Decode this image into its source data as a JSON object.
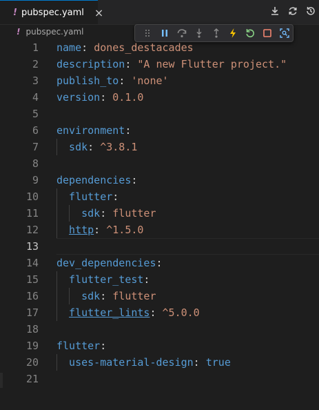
{
  "tab": {
    "filename": "pubspec.yaml",
    "close_label": "×",
    "marker": "!"
  },
  "breadcrumb": {
    "filename": "pubspec.yaml",
    "marker": "!"
  },
  "toolbar_icons": [
    "download-icon",
    "sync-icon",
    "history-icon"
  ],
  "debug_toolbar": [
    "drag-grip-icon",
    "pause-icon",
    "step-over-icon",
    "step-into-icon",
    "step-out-icon",
    "hot-reload-icon",
    "restart-icon",
    "stop-icon",
    "inspect-widget-icon"
  ],
  "colors": {
    "key": "#569cd6",
    "string": "#ce9178",
    "punct": "#d4d4d4",
    "lineNumber": "#858585",
    "accent": "#007acc",
    "yamlMarker": "#c586c0"
  },
  "current_line": 13,
  "lines": [
    {
      "n": "1",
      "indent": 0,
      "parts": [
        {
          "t": "name",
          "c": "k"
        },
        {
          "t": ": ",
          "c": "p"
        },
        {
          "t": "dones_destacades",
          "c": "s"
        }
      ]
    },
    {
      "n": "2",
      "indent": 0,
      "parts": [
        {
          "t": "description",
          "c": "k"
        },
        {
          "t": ": ",
          "c": "p"
        },
        {
          "t": "\"A new Flutter project.\"",
          "c": "s"
        }
      ]
    },
    {
      "n": "3",
      "indent": 0,
      "parts": [
        {
          "t": "publish_to",
          "c": "k"
        },
        {
          "t": ": ",
          "c": "p"
        },
        {
          "t": "'none'",
          "c": "s"
        }
      ]
    },
    {
      "n": "4",
      "indent": 0,
      "parts": [
        {
          "t": "version",
          "c": "k"
        },
        {
          "t": ": ",
          "c": "p"
        },
        {
          "t": "0.1.0",
          "c": "s"
        }
      ]
    },
    {
      "n": "5",
      "indent": 0,
      "parts": []
    },
    {
      "n": "6",
      "indent": 0,
      "parts": [
        {
          "t": "environment",
          "c": "k"
        },
        {
          "t": ":",
          "c": "p"
        }
      ]
    },
    {
      "n": "7",
      "indent": 1,
      "parts": [
        {
          "t": "sdk",
          "c": "k"
        },
        {
          "t": ": ",
          "c": "p"
        },
        {
          "t": "^3.8.1",
          "c": "s"
        }
      ]
    },
    {
      "n": "8",
      "indent": 0,
      "parts": []
    },
    {
      "n": "9",
      "indent": 0,
      "parts": [
        {
          "t": "dependencies",
          "c": "k"
        },
        {
          "t": ":",
          "c": "p"
        }
      ]
    },
    {
      "n": "10",
      "indent": 1,
      "parts": [
        {
          "t": "flutter",
          "c": "k"
        },
        {
          "t": ":",
          "c": "p"
        }
      ]
    },
    {
      "n": "11",
      "indent": 2,
      "parts": [
        {
          "t": "sdk",
          "c": "k"
        },
        {
          "t": ": ",
          "c": "p"
        },
        {
          "t": "flutter",
          "c": "s"
        }
      ]
    },
    {
      "n": "12",
      "indent": 1,
      "parts": [
        {
          "t": "http",
          "c": "k u"
        },
        {
          "t": ": ",
          "c": "p"
        },
        {
          "t": "^1.5.0",
          "c": "s"
        }
      ]
    },
    {
      "n": "13",
      "indent": 0,
      "parts": []
    },
    {
      "n": "14",
      "indent": 0,
      "parts": [
        {
          "t": "dev_dependencies",
          "c": "k"
        },
        {
          "t": ":",
          "c": "p"
        }
      ]
    },
    {
      "n": "15",
      "indent": 1,
      "parts": [
        {
          "t": "flutter_test",
          "c": "k"
        },
        {
          "t": ":",
          "c": "p"
        }
      ]
    },
    {
      "n": "16",
      "indent": 2,
      "parts": [
        {
          "t": "sdk",
          "c": "k"
        },
        {
          "t": ": ",
          "c": "p"
        },
        {
          "t": "flutter",
          "c": "s"
        }
      ]
    },
    {
      "n": "17",
      "indent": 1,
      "parts": [
        {
          "t": "flutter_lints",
          "c": "k u"
        },
        {
          "t": ": ",
          "c": "p"
        },
        {
          "t": "^5.0.0",
          "c": "s"
        }
      ]
    },
    {
      "n": "18",
      "indent": 0,
      "parts": []
    },
    {
      "n": "19",
      "indent": 0,
      "parts": [
        {
          "t": "flutter",
          "c": "k"
        },
        {
          "t": ":",
          "c": "p"
        }
      ]
    },
    {
      "n": "20",
      "indent": 1,
      "parts": [
        {
          "t": "uses-material-design",
          "c": "k"
        },
        {
          "t": ": ",
          "c": "p"
        },
        {
          "t": "true",
          "c": "k"
        }
      ]
    },
    {
      "n": "21",
      "indent": 0,
      "parts": []
    }
  ]
}
